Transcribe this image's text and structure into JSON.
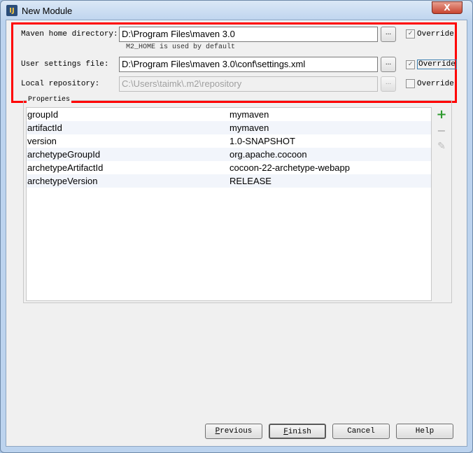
{
  "window": {
    "title": "New Module",
    "close_label": "X"
  },
  "form": {
    "maven_home": {
      "label": "Maven home directory:",
      "value": "D:\\Program Files\\maven 3.0",
      "hint": "M2_HOME is used by default",
      "override_label": "Override",
      "override": true
    },
    "user_settings": {
      "label": "User settings file:",
      "value": "D:\\Program Files\\maven 3.0\\conf\\settings.xml",
      "override_label": "Override",
      "override": true
    },
    "local_repo": {
      "label": "Local repository:",
      "value": "C:\\Users\\taimk\\.m2\\repository",
      "override_label": "Override",
      "override": false
    },
    "browse_label": "..."
  },
  "properties": {
    "title": "Properties",
    "rows": [
      [
        "groupId",
        "mymaven"
      ],
      [
        "artifactId",
        "mymaven"
      ],
      [
        "version",
        "1.0-SNAPSHOT"
      ],
      [
        "archetypeGroupId",
        "org.apache.cocoon"
      ],
      [
        "archetypeArtifactId",
        "cocoon-22-archetype-webapp"
      ],
      [
        "archetypeVersion",
        "RELEASE"
      ]
    ]
  },
  "buttons": {
    "previous": "Previous",
    "finish": "Finish",
    "cancel": "Cancel",
    "help": "Help"
  }
}
